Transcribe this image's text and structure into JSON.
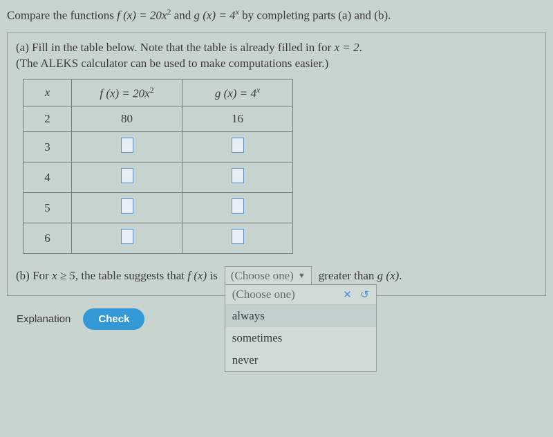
{
  "chart_data": {
    "type": "table",
    "title": "Compare f(x)=20x^2 and g(x)=4^x",
    "columns": [
      "x",
      "f(x)=20x^2",
      "g(x)=4^x"
    ],
    "rows": [
      {
        "x": 2,
        "f": 80,
        "g": 16
      },
      {
        "x": 3,
        "f": null,
        "g": null
      },
      {
        "x": 4,
        "f": null,
        "g": null
      },
      {
        "x": 5,
        "f": null,
        "g": null
      },
      {
        "x": 6,
        "f": null,
        "g": null
      }
    ]
  },
  "question": {
    "prefix": "Compare the functions ",
    "f_expr": "f (x) = 20x",
    "f_sup": "2",
    "mid": " and ",
    "g_expr": "g (x) = 4",
    "g_sup": "x",
    "suffix": " by completing parts (a) and (b)."
  },
  "partA": {
    "line1_prefix": "(a) Fill in the table below. Note that the table is already filled in for ",
    "xeq": "x = 2",
    "line1_suffix": ".",
    "line2": "(The ALEKS calculator can be used to make computations easier.)"
  },
  "table": {
    "head_x": "x",
    "head_f_pre": "f (x) = 20x",
    "head_f_sup": "2",
    "head_g_pre": "g (x) = 4",
    "head_g_sup": "x",
    "rows": [
      {
        "x": "2",
        "f": "80",
        "g": "16"
      },
      {
        "x": "3",
        "f": "",
        "g": ""
      },
      {
        "x": "4",
        "f": "",
        "g": ""
      },
      {
        "x": "5",
        "f": "",
        "g": ""
      },
      {
        "x": "6",
        "f": "",
        "g": ""
      }
    ]
  },
  "partB": {
    "prefix": "(b) For ",
    "cond": "x ≥ 5",
    "mid1": ", the table suggests that ",
    "fx": "f (x)",
    "mid2": " is",
    "trailing_pre": "greater than ",
    "gx": "g (x)",
    "trailing_suf": "."
  },
  "dropdown": {
    "selected": "(Choose one)",
    "header": "(Choose one)",
    "options": [
      "always",
      "sometimes",
      "never"
    ]
  },
  "buttons": {
    "explanation": "Explanation",
    "check": "Check"
  }
}
